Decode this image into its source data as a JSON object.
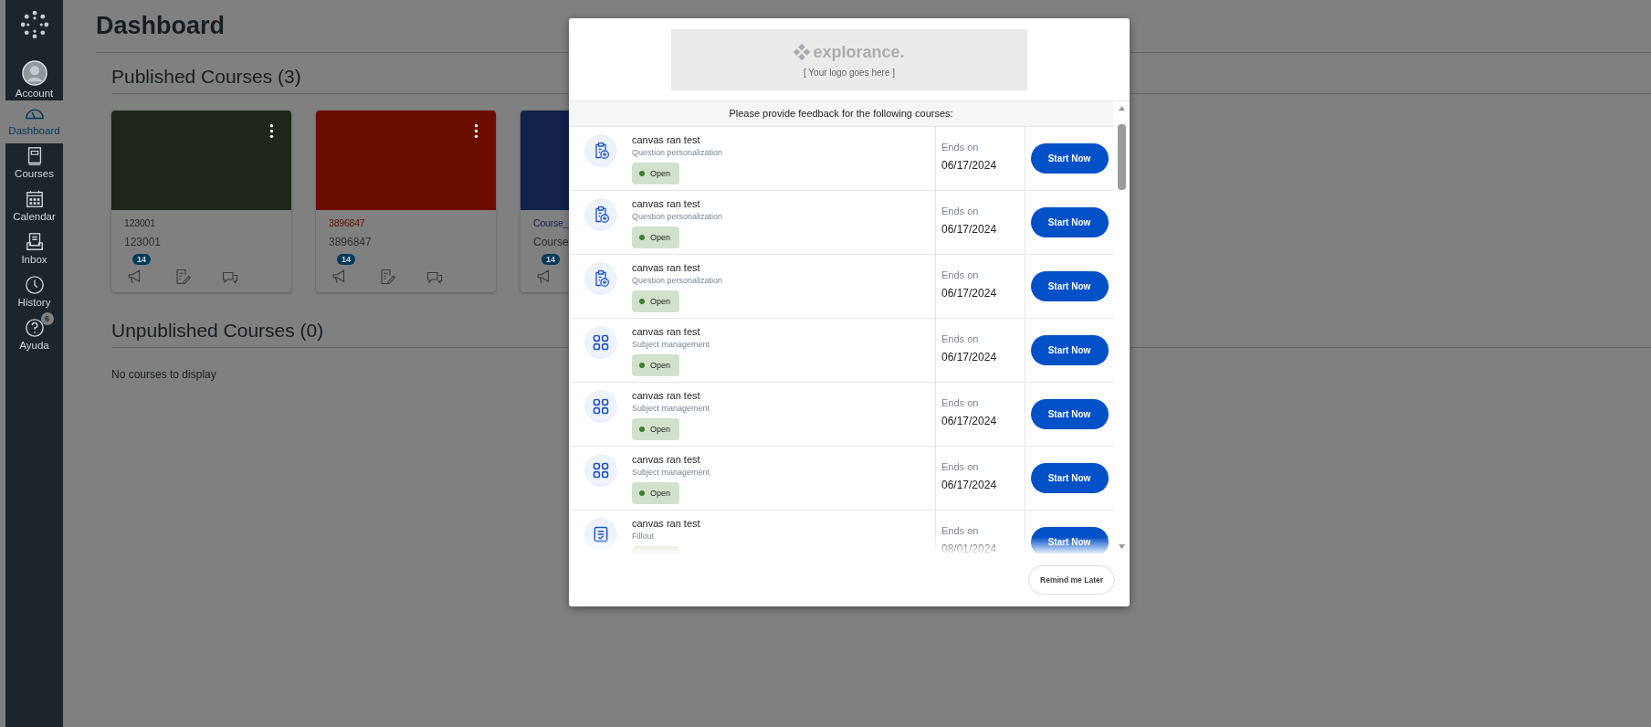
{
  "sidebar": {
    "items": [
      {
        "label": "Account",
        "kind": "avatar",
        "selected": false
      },
      {
        "label": "Dashboard",
        "kind": "dashboard",
        "selected": true
      },
      {
        "label": "Courses",
        "kind": "courses",
        "selected": false
      },
      {
        "label": "Calendar",
        "kind": "calendar",
        "selected": false
      },
      {
        "label": "Inbox",
        "kind": "inbox",
        "selected": false
      },
      {
        "label": "History",
        "kind": "history",
        "selected": false
      },
      {
        "label": "Ayuda",
        "kind": "help",
        "selected": false,
        "badge": "6"
      }
    ]
  },
  "page": {
    "title": "Dashboard",
    "published": {
      "heading": "Published Courses (3)",
      "cards": [
        {
          "color": "#1e261c",
          "title": "123001",
          "subtitle": "123001",
          "menu": true,
          "badge": "14",
          "actions": [
            {
              "kind": "announcements"
            },
            {
              "kind": "assignments"
            },
            {
              "kind": "discussions"
            }
          ]
        },
        {
          "color": "#6b0c00",
          "title": "3896847",
          "subtitle": "3896847",
          "menu": true,
          "badge": "14",
          "actions": [
            {
              "kind": "announcements"
            },
            {
              "kind": "assignments"
            },
            {
              "kind": "discussions"
            }
          ]
        },
        {
          "color": "#12204a",
          "title": "Course_",
          "subtitle": "Course",
          "badge": "14",
          "actions": [
            {
              "kind": "announcements"
            }
          ]
        }
      ]
    },
    "unpublished": {
      "heading": "Unpublished Courses (0)",
      "empty": "No courses to display"
    }
  },
  "modal": {
    "logo": {
      "brand": "explorance.",
      "caption": "[ Your logo goes here ]"
    },
    "intro": "Please provide feedback for the following courses:",
    "rows": [
      {
        "kind": "questions",
        "title": "canvas ran test",
        "subtitle": "Question personalization",
        "badge": true,
        "status": "Open",
        "ends_label": "Ends on",
        "date": "06/17/2024",
        "button": "Start Now"
      },
      {
        "kind": "questions",
        "title": "canvas ran test",
        "subtitle": "Question personalization",
        "badge": true,
        "status": "Open",
        "ends_label": "Ends on",
        "date": "06/17/2024",
        "button": "Start Now"
      },
      {
        "kind": "questions",
        "title": "canvas ran test",
        "subtitle": "Question personalization",
        "badge": true,
        "status": "Open",
        "ends_label": "Ends on",
        "date": "06/17/2024",
        "button": "Start Now"
      },
      {
        "kind": "subject",
        "title": "canvas ran test",
        "subtitle": "Subject management",
        "badge": true,
        "status": "Open",
        "ends_label": "Ends on",
        "date": "06/17/2024",
        "button": "Start Now"
      },
      {
        "kind": "subject",
        "title": "canvas ran test",
        "subtitle": "Subject management",
        "badge": true,
        "status": "Open",
        "ends_label": "Ends on",
        "date": "06/17/2024",
        "button": "Start Now"
      },
      {
        "kind": "subject",
        "title": "canvas ran test",
        "subtitle": "Subject management",
        "badge": true,
        "status": "Open",
        "ends_label": "Ends on",
        "date": "06/17/2024",
        "button": "Start Now"
      },
      {
        "kind": "fillout",
        "title": "canvas ran test",
        "subtitle": "Fillout",
        "badge": true,
        "ends_label": "Ends on",
        "date": "08/01/2024",
        "button": "Start Now"
      }
    ],
    "remind": "Remind me Later"
  }
}
